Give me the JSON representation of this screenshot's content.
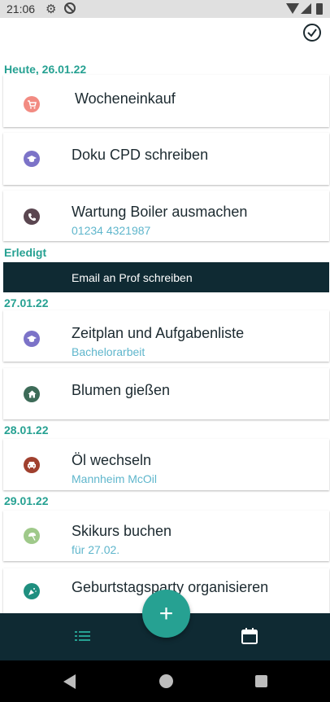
{
  "status_bar": {
    "time": "21:06",
    "icons": [
      "gear-icon",
      "do-not-disturb-icon",
      "wifi-icon",
      "signal-icon",
      "battery-icon"
    ]
  },
  "header": {
    "action_icon": "check-circle-icon"
  },
  "sections": {
    "today": "Heute, 26.01.22",
    "done": "Erledigt",
    "d27": "27.01.22",
    "d28": "28.01.22",
    "d29": "29.01.22"
  },
  "tasks": [
    {
      "title": "Wocheneinkauf",
      "subtitle": "",
      "icon": "shopping-cart-icon",
      "color": "#f28b82"
    },
    {
      "title": "Doku CPD schreiben",
      "subtitle": "",
      "icon": "graduation-cap-icon",
      "color": "#7c73c8"
    },
    {
      "title": "Wartung Boiler ausmachen",
      "subtitle": "01234 4321987",
      "icon": "phone-icon",
      "color": "#5a4650"
    },
    {
      "title": "Zeitplan und Aufgabenliste",
      "subtitle": "Bachelorarbeit",
      "icon": "graduation-cap-icon",
      "color": "#7c73c8"
    },
    {
      "title": "Blumen gießen",
      "subtitle": "",
      "icon": "home-icon",
      "color": "#3d6b58"
    },
    {
      "title": "Öl wechseln",
      "subtitle": "Mannheim McOil",
      "icon": "car-icon",
      "color": "#a0402e"
    },
    {
      "title": "Skikurs buchen",
      "subtitle": "für 27.02.",
      "icon": "beach-umbrella-icon",
      "color": "#9fc98a"
    },
    {
      "title": "Geburtstagsparty organisieren",
      "subtitle": "",
      "icon": "party-popper-icon",
      "color": "#1f8f7f"
    }
  ],
  "done_tasks": [
    {
      "title": "Email an Prof schreiben"
    }
  ],
  "bottom_nav": {
    "fab_label": "+",
    "left_icon": "list-icon",
    "right_icon": "calendar-icon"
  },
  "colors": {
    "accent": "#26a192",
    "dark": "#0f2a33",
    "subtitle": "#5fb6cc"
  }
}
